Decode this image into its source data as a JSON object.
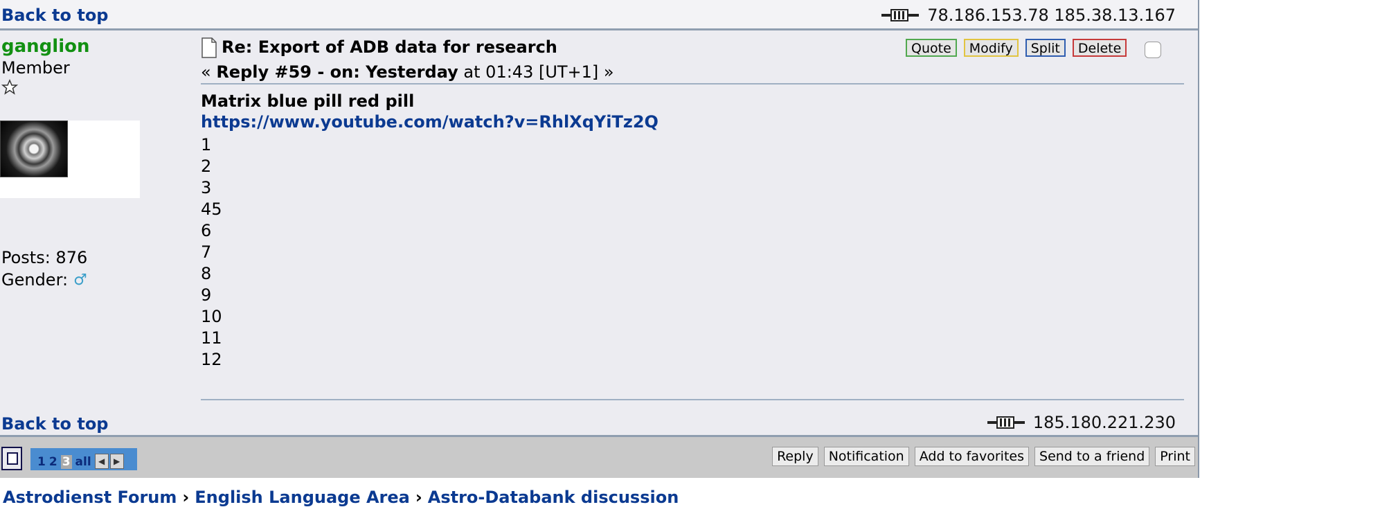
{
  "top": {
    "back_to_top": "Back to top",
    "ips": "78.186.153.78 185.38.13.167"
  },
  "user": {
    "name": "ganglion",
    "rank": "Member",
    "posts": "Posts: 876",
    "gender_label": "Gender:",
    "gender_symbol": "♂"
  },
  "post": {
    "subject": "Re: Export of ADB data for research",
    "reply_prefix": "« ",
    "reply_bold": "Reply #59 - on: Yesterday",
    "reply_rest": " at 01:43 [UT+1] »",
    "buttons": {
      "quote": "Quote",
      "modify": "Modify",
      "split": "Split",
      "delete": "Delete"
    },
    "title": "Matrix blue pill red pill",
    "link": "https://www.youtube.com/watch?v=RhlXqYiTz2Q",
    "numbers": [
      "1",
      "2",
      "3",
      "45",
      "6",
      "7",
      "8",
      "9",
      "10",
      "11",
      "12"
    ]
  },
  "bottom": {
    "back_to_top": "Back to top",
    "ip": "185.180.221.230"
  },
  "footer": {
    "pages": [
      "1",
      "2",
      "3",
      "all"
    ],
    "current_page": "3",
    "actions": [
      "Reply",
      "Notification",
      "Add to favorites",
      "Send to a friend",
      "Print"
    ]
  },
  "breadcrumb": [
    "Astrodienst Forum",
    "English Language Area",
    "Astro-Databank discussion"
  ],
  "colors": {
    "link": "#0b3a91",
    "username": "#129012",
    "background": "#ececf1"
  }
}
